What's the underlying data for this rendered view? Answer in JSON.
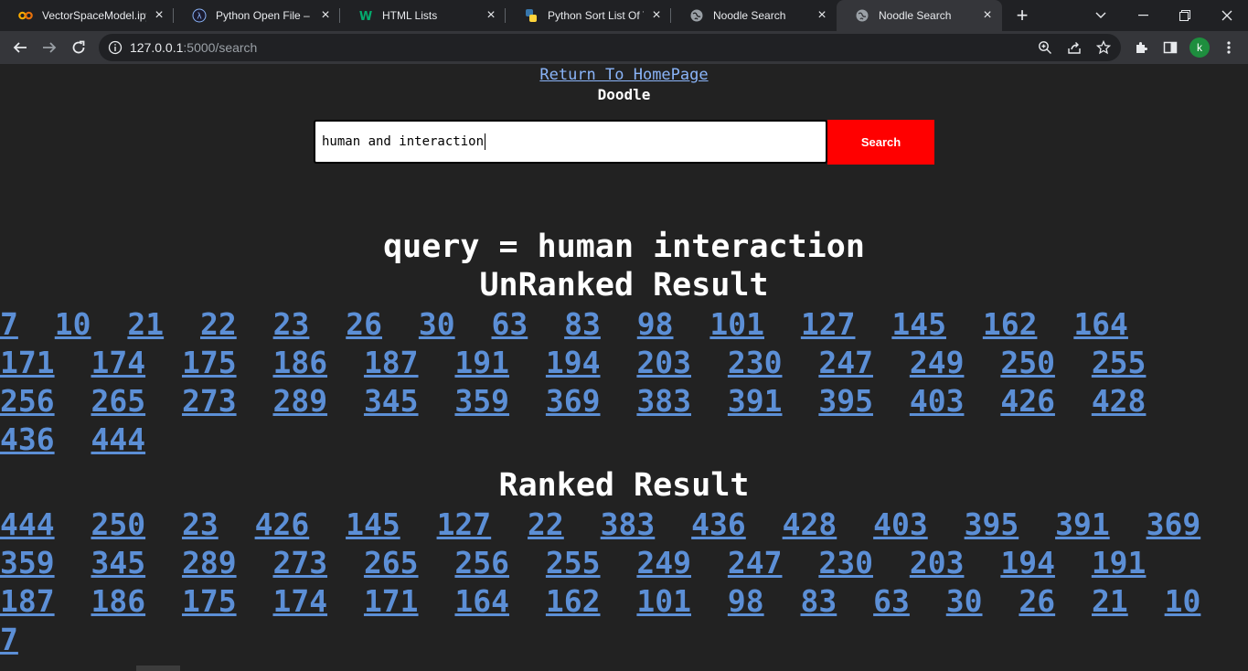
{
  "tabs": [
    {
      "title": "VectorSpaceModel.ipy",
      "icon": "colab-icon"
    },
    {
      "title": "Python Open File – Ho",
      "icon": "lambda-icon"
    },
    {
      "title": "HTML Lists",
      "icon": "w3schools-icon"
    },
    {
      "title": "Python Sort List Of Tu",
      "icon": "python-icon"
    },
    {
      "title": "Noodle Search",
      "icon": "globe-icon"
    },
    {
      "title": "Noodle Search",
      "icon": "globe-icon"
    }
  ],
  "address": {
    "host": "127.0.0.1",
    "rest": ":5000/search"
  },
  "profile_initial": "k",
  "page": {
    "home_link": "Return To HomePage",
    "brand": "Doodle",
    "search_value": "human and interaction",
    "search_button": "Search",
    "query_heading": "query = human interaction",
    "unranked_heading": "UnRanked Result",
    "ranked_heading": "Ranked Result"
  },
  "unranked": [
    "7",
    "10",
    "21",
    "22",
    "23",
    "26",
    "30",
    "63",
    "83",
    "98",
    "101",
    "127",
    "145",
    "162",
    "164",
    "171",
    "174",
    "175",
    "186",
    "187",
    "191",
    "194",
    "203",
    "230",
    "247",
    "249",
    "250",
    "255",
    "256",
    "265",
    "273",
    "289",
    "345",
    "359",
    "369",
    "383",
    "391",
    "395",
    "403",
    "426",
    "428",
    "436",
    "444"
  ],
  "ranked": [
    "444",
    "250",
    "23",
    "426",
    "145",
    "127",
    "22",
    "383",
    "436",
    "428",
    "403",
    "395",
    "391",
    "369",
    "359",
    "345",
    "289",
    "273",
    "265",
    "256",
    "255",
    "249",
    "247",
    "230",
    "203",
    "194",
    "191",
    "187",
    "186",
    "175",
    "174",
    "171",
    "164",
    "162",
    "101",
    "98",
    "83",
    "63",
    "30",
    "26",
    "21",
    "10",
    "7"
  ],
  "colors": {
    "accent_button": "#ff0000",
    "link": "#5c8fd6",
    "page_bg": "#222222"
  }
}
